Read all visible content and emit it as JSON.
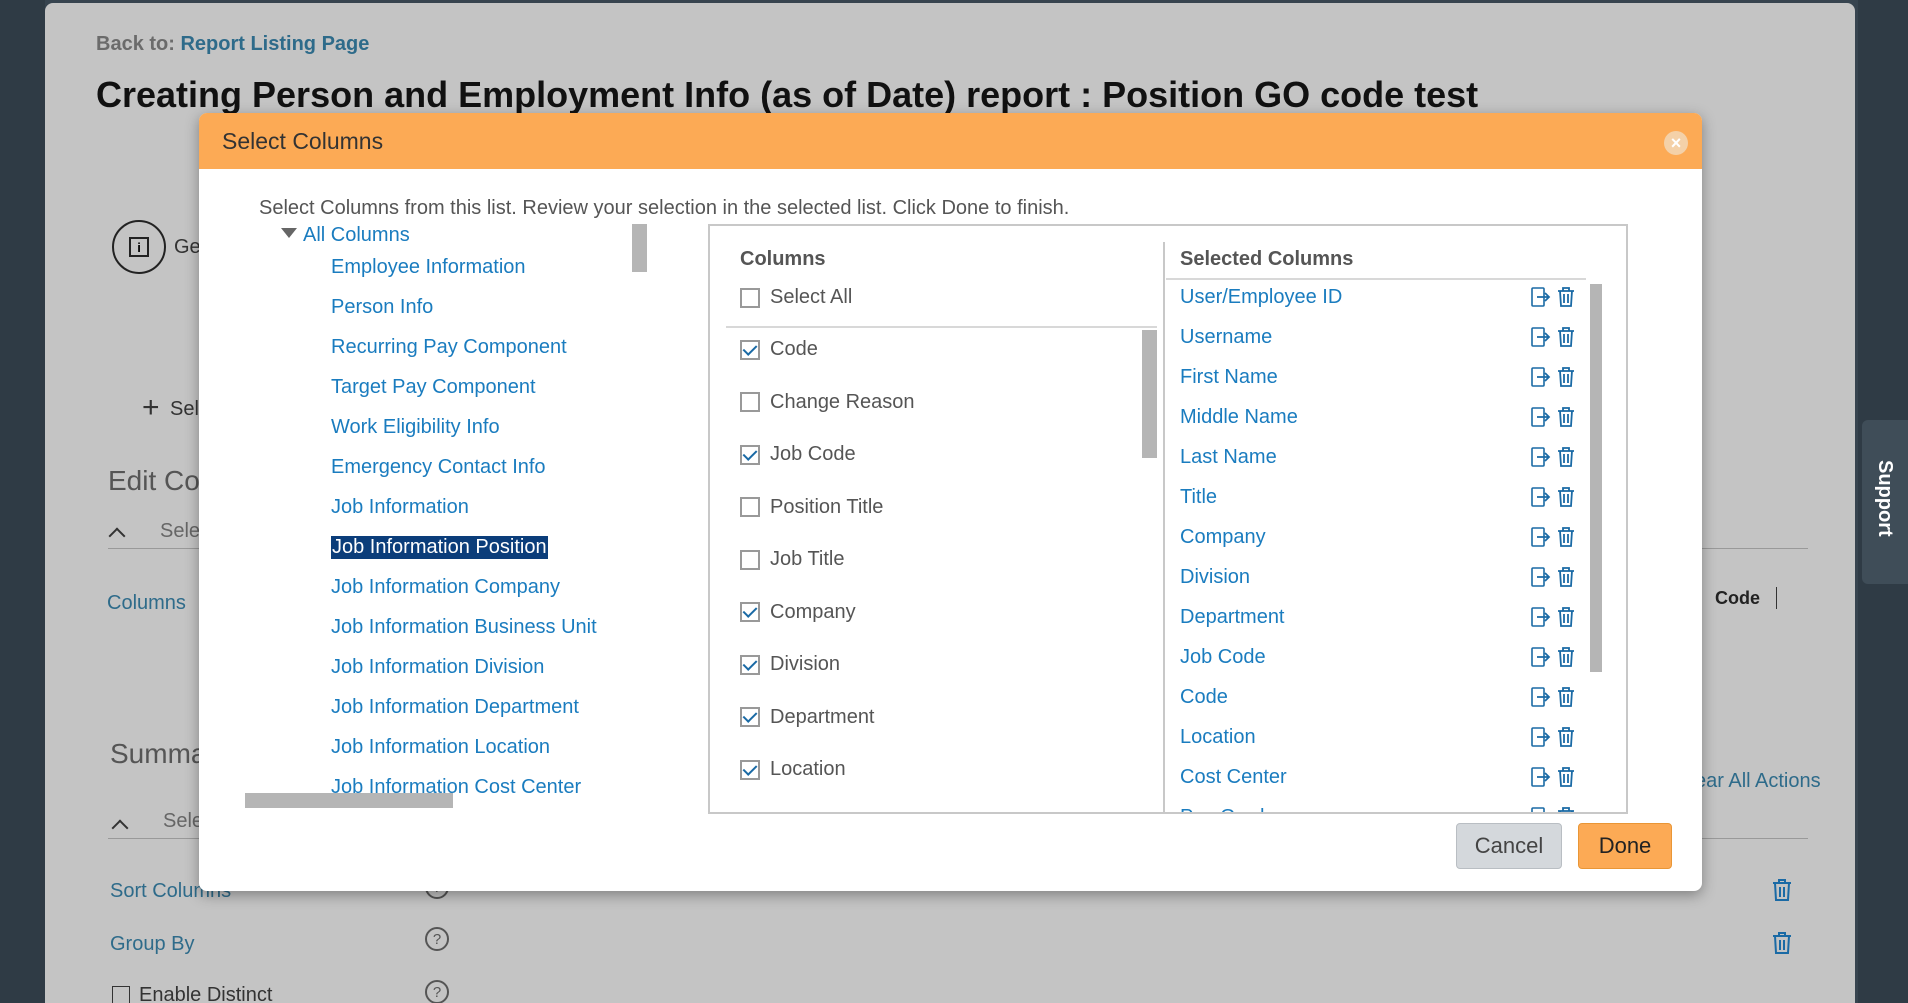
{
  "background": {
    "back_prefix": "Back to:",
    "back_link": "Report Listing Page",
    "page_title": "Creating Person and Employment Info (as of Date) report : Position GO code test",
    "info_icon": "info-icon",
    "general_tab_partial": "Ge",
    "add_partial": "Sele",
    "edit_heading_partial": "Edit Co",
    "select_partial_1": "Sele",
    "columns_partial": "Columns",
    "code_label": "Code",
    "summary_partial": "Summa",
    "select_partial_2": "Sele",
    "clear_all_partial": "ear All Actions",
    "sort_columns": "Sort Columns",
    "group_by": "Group By",
    "enable_distinct": "Enable Distinct",
    "support": "Support"
  },
  "modal": {
    "title": "Select Columns",
    "instruction": "Select Columns from this list. Review your selection in the selected list. Click Done to finish.",
    "tree": {
      "root": "All Columns",
      "items": [
        "Employee Information",
        "Person Info",
        "Recurring Pay Component",
        "Target Pay Component",
        "Work Eligibility Info",
        "Emergency Contact Info",
        "Job Information",
        "Job Information Position",
        "Job Information Company",
        "Job Information Business Unit",
        "Job Information Division",
        "Job Information Department",
        "Job Information Location",
        "Job Information Cost Center"
      ],
      "selected_index": 7
    },
    "columns": {
      "heading": "Columns",
      "select_all": "Select All",
      "items": [
        {
          "label": "Code",
          "checked": true
        },
        {
          "label": "Change Reason",
          "checked": false
        },
        {
          "label": "Job Code",
          "checked": true
        },
        {
          "label": "Position Title",
          "checked": false
        },
        {
          "label": "Job Title",
          "checked": false
        },
        {
          "label": "Company",
          "checked": true
        },
        {
          "label": "Division",
          "checked": true
        },
        {
          "label": "Department",
          "checked": true
        },
        {
          "label": "Location",
          "checked": true
        }
      ]
    },
    "selected": {
      "heading": "Selected Columns",
      "items": [
        "User/Employee ID",
        "Username",
        "First Name",
        "Middle Name",
        "Last Name",
        "Title",
        "Company",
        "Division",
        "Department",
        "Job Code",
        "Code",
        "Location",
        "Cost Center",
        "Pay Grade"
      ]
    },
    "buttons": {
      "cancel": "Cancel",
      "done": "Done"
    },
    "colors": {
      "header": "#fcaa55",
      "link": "#1a7cbf",
      "selected_bg": "#0b3d7a"
    }
  }
}
